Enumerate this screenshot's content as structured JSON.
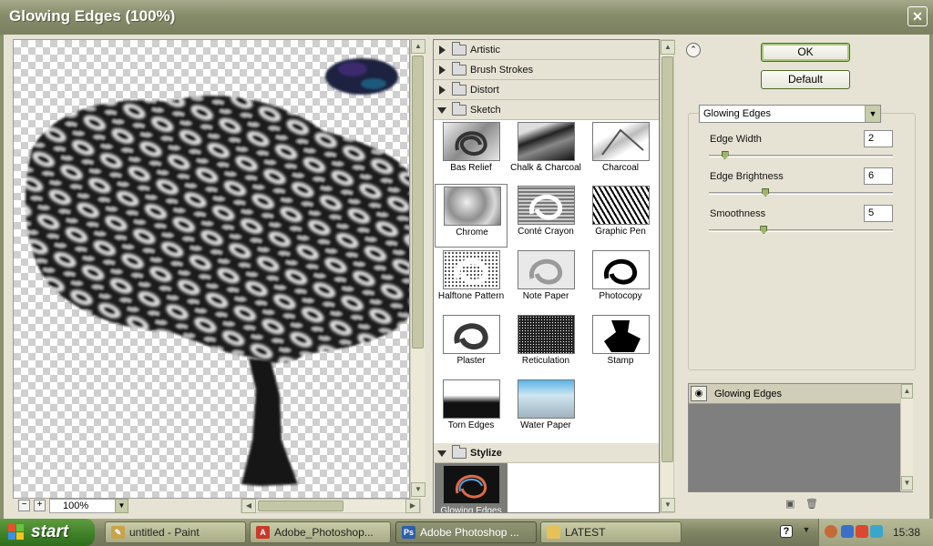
{
  "window": {
    "title": "Glowing Edges (100%)",
    "close_glyph": "✕"
  },
  "preview": {
    "zoom": "100%",
    "zoom_minus": "−",
    "zoom_plus": "+"
  },
  "categories": [
    {
      "label": "Artistic",
      "expanded": false
    },
    {
      "label": "Brush Strokes",
      "expanded": false
    },
    {
      "label": "Distort",
      "expanded": false
    },
    {
      "label": "Sketch",
      "expanded": true
    },
    {
      "label": "Stylize",
      "expanded": true
    }
  ],
  "sketch_filters": [
    "Bas Relief",
    "Chalk & Charcoal",
    "Charcoal",
    "Chrome",
    "Conté Crayon",
    "Graphic Pen",
    "Halftone Pattern",
    "Note Paper",
    "Photocopy",
    "Plaster",
    "Reticulation",
    "Stamp",
    "Torn Edges",
    "Water Paper"
  ],
  "stylize_filters": [
    "Glowing Edges"
  ],
  "buttons": {
    "ok": "OK",
    "default": "Default",
    "collapse": "⌃"
  },
  "settings": {
    "filter_name": "Glowing Edges",
    "params": [
      {
        "label": "Edge Width",
        "value": "2",
        "fraction": 0.07
      },
      {
        "label": "Edge Brightness",
        "value": "6",
        "fraction": 0.3
      },
      {
        "label": "Smoothness",
        "value": "5",
        "fraction": 0.29
      }
    ]
  },
  "layers": [
    {
      "name": "Glowing Edges",
      "visible": true
    }
  ],
  "taskbar": {
    "start": "start",
    "tasks": [
      "untitled - Paint",
      "Adobe_Photoshop...",
      "Adobe Photoshop ...",
      "LATEST"
    ],
    "clock": "15:38"
  },
  "colors": {
    "ok_border": "#a6c878",
    "taskbar": "#7e8363",
    "start": "#3e7f26"
  }
}
